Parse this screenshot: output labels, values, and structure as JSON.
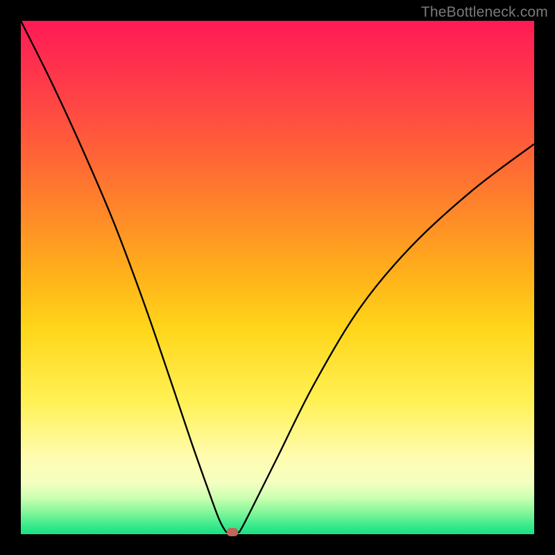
{
  "watermark": "TheBottleneck.com",
  "colors": {
    "frame": "#000000",
    "curve": "#000000",
    "marker": "#c1645a",
    "gradient_top": "#ff1a55",
    "gradient_bottom": "#1ee082"
  },
  "chart_data": {
    "type": "line",
    "title": "",
    "xlabel": "",
    "ylabel": "",
    "xlim": [
      0,
      100
    ],
    "ylim": [
      0,
      100
    ],
    "grid": false,
    "legend": false,
    "series": [
      {
        "name": "bottleneck-curve",
        "x": [
          0,
          6,
          12,
          18,
          24,
          29.5,
          33.2,
          36.2,
          38.5,
          39.8,
          40.3,
          40.4,
          42.1,
          42.8,
          45,
          50,
          57,
          66,
          76,
          88,
          100
        ],
        "values": [
          100,
          88,
          75,
          61,
          45,
          29,
          18,
          9.5,
          3.2,
          0.7,
          0.4,
          0.4,
          0.4,
          0.8,
          5,
          15,
          29,
          44,
          56,
          67,
          76
        ]
      }
    ],
    "annotations": [
      {
        "name": "min-marker",
        "x": 41.2,
        "y": 0.4
      }
    ]
  }
}
